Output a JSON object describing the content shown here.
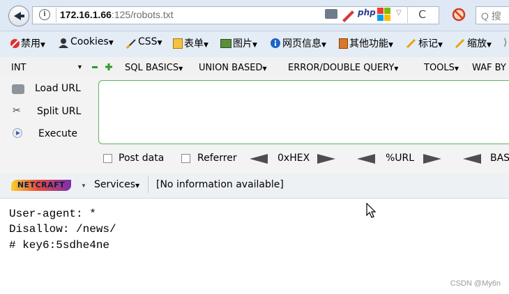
{
  "url_bar": {
    "address_host": "172.16.1.66",
    "address_rest": ":125/robots.txt",
    "php_label": "php",
    "search_placeholder": "Q 搜"
  },
  "menu": {
    "items": [
      "禁用",
      "Cookies",
      "CSS",
      "表单",
      "图片",
      "网页信息",
      "其他功能",
      "标记",
      "缩放"
    ]
  },
  "hackbar": {
    "type_select": "INT",
    "menus": [
      "SQL BASICS",
      "UNION BASED",
      "ERROR/DOUBLE QUERY",
      "TOOLS",
      "WAF BY"
    ],
    "load_url": "Load URL",
    "split_url": "Split URL",
    "execute": "Execute",
    "post_data": "Post data",
    "referrer": "Referrer",
    "hex": "0xHEX",
    "url_enc": "%URL",
    "base": "BAS"
  },
  "netcraft": {
    "logo": "NETCRAFT",
    "services": "Services",
    "info": "[No information available]"
  },
  "content": {
    "lines": [
      "User-agent: *",
      "Disallow: /news/",
      "# key6:5sdhe4ne"
    ]
  },
  "watermark": "CSDN @My6n"
}
